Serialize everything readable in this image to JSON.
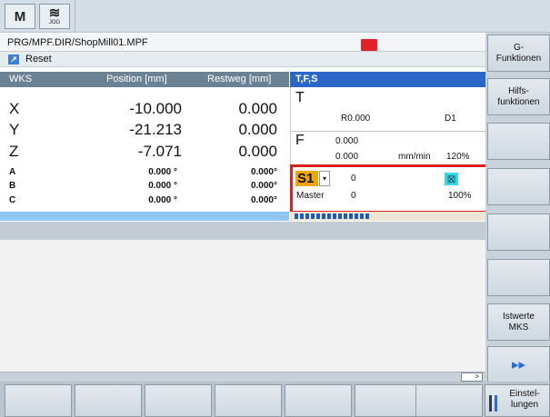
{
  "top_bar": {
    "mode_icon_1": "M",
    "mode_icon_2_glyph": "≋",
    "mode_icon_2_label": "JOG"
  },
  "program": {
    "path": "PRG/MPF.DIR/ShopMill01.MPF",
    "status": "Reset"
  },
  "axes_panel": {
    "headers": {
      "coord": "WKS",
      "position": "Position [mm]",
      "distance": "Restweg [mm]"
    },
    "axes": [
      {
        "name": "X",
        "position": "-10.000",
        "distance": "0.000"
      },
      {
        "name": "Y",
        "position": "-21.213",
        "distance": "0.000"
      },
      {
        "name": "Z",
        "position": "-7.071",
        "distance": "0.000"
      },
      {
        "name": "A",
        "position": "0.000 °",
        "distance": "0.000°"
      },
      {
        "name": "B",
        "position": "0.000 °",
        "distance": "0.000°"
      },
      {
        "name": "C",
        "position": "0.000 °",
        "distance": "0.000°"
      }
    ]
  },
  "tfs_panel": {
    "header": "T,F,S",
    "tool": {
      "label": "T",
      "radius": "R0.000",
      "offset": "D1"
    },
    "feed": {
      "label": "F",
      "value": "0.000",
      "actual": "0.000",
      "unit": "mm/min",
      "override": "120%"
    },
    "spindle": {
      "label": "S1",
      "dropdown": "▾",
      "value": "0",
      "role": "Master",
      "role_value": "0",
      "override": "100%",
      "override_fraction": 0.42
    }
  },
  "right_softkeys": [
    "G-\nFunktionen",
    "Hilfs-\nfunktionen",
    "",
    "",
    "",
    "",
    "Istwerte\nMKS",
    "▸▸"
  ],
  "bottom_softkeys": [
    "",
    "",
    "",
    "",
    "",
    "",
    "",
    "Einstel-\nlungen"
  ],
  "colors": {
    "highlight": "#e02020",
    "spindle_badge": "#f0a500",
    "header_blue": "#2a66c8",
    "header_gray": "#6b8194"
  },
  "icons": {
    "mode_1": "machine-icon",
    "mode_2": "jog-icon",
    "reset": "reset-icon",
    "alarm": "alarm-icon",
    "spindle": "spindle-stop-icon",
    "dropdown": "chevron-down-icon",
    "next": "double-arrow-right-icon",
    "settings": "settings-icon"
  }
}
